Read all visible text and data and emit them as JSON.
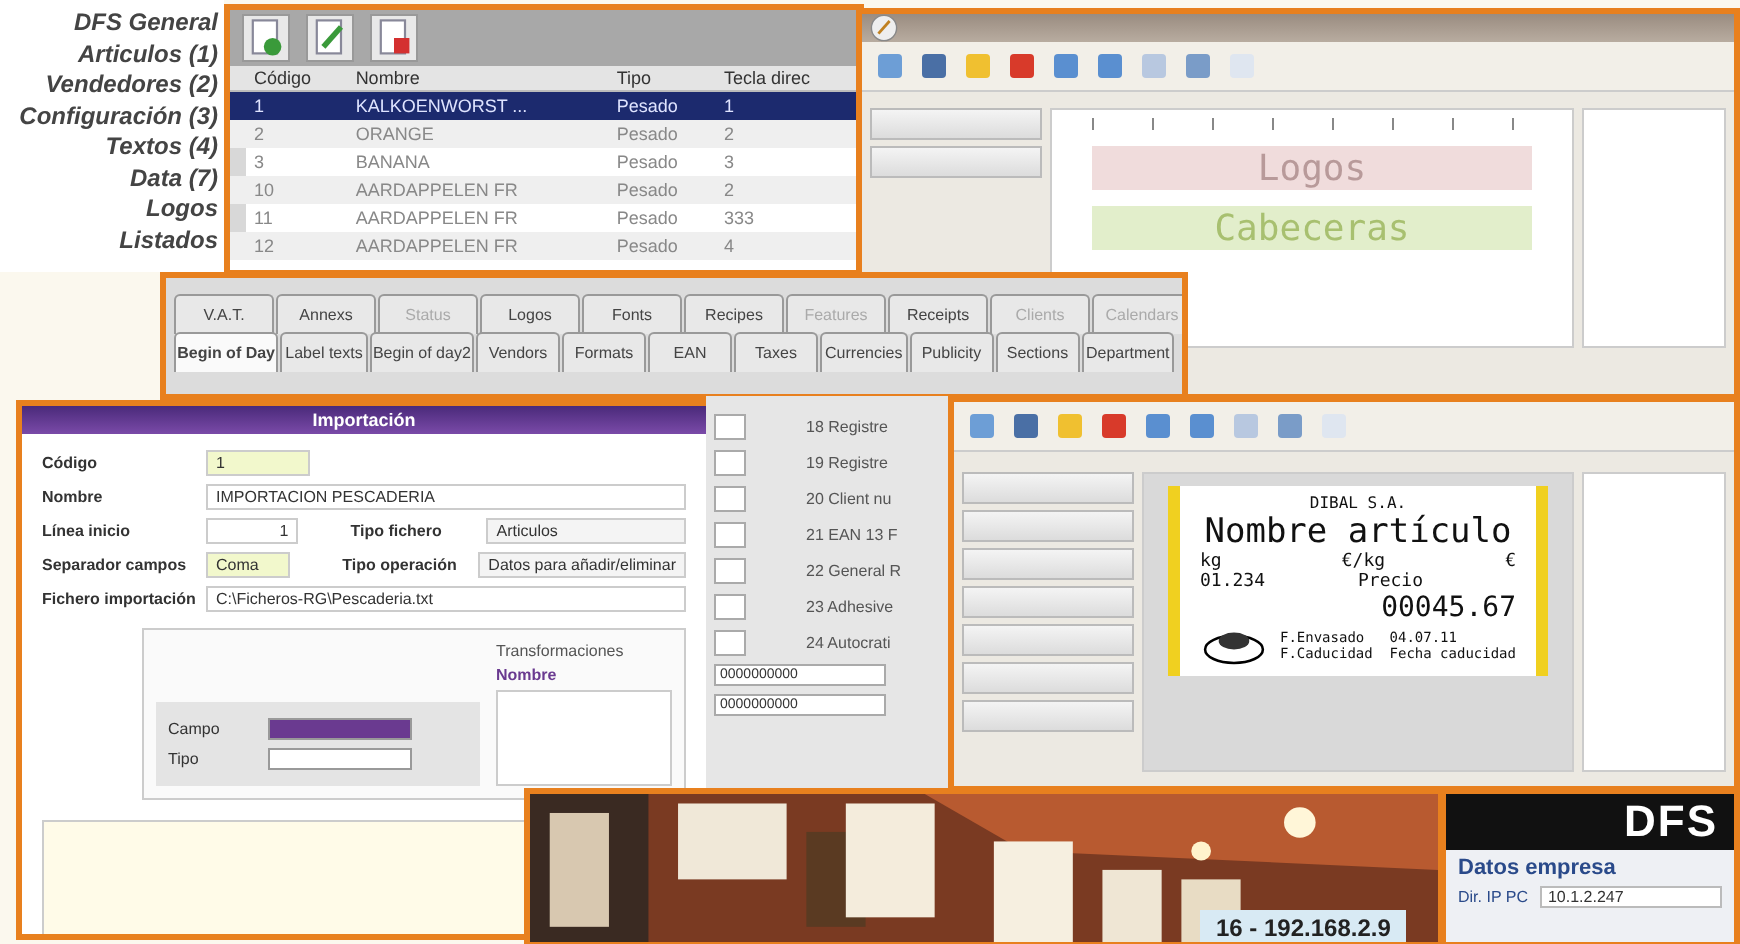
{
  "nav": {
    "items": [
      "DFS General",
      "Articulos (1)",
      "Vendedores (2)",
      "Configuración (3)",
      "Textos (4)",
      "Data (7)",
      "Logos",
      "Listados"
    ]
  },
  "articles_window": {
    "columns": [
      "Código",
      "Nombre",
      "Tipo",
      "Tecla direc"
    ],
    "rows": [
      {
        "cells": [
          "1",
          "KALKOENWORST ...",
          "Pesado",
          "1"
        ],
        "selected": true
      },
      {
        "cells": [
          "2",
          "ORANGE",
          "Pesado",
          "2"
        ],
        "selected": false
      },
      {
        "cells": [
          "3",
          "BANANA",
          "Pesado",
          "3"
        ],
        "selected": false
      },
      {
        "cells": [
          "10",
          "AARDAPPELEN FR",
          "Pesado",
          "2"
        ],
        "selected": false
      },
      {
        "cells": [
          "11",
          "AARDAPPELEN FR",
          "Pesado",
          "333"
        ],
        "selected": false
      },
      {
        "cells": [
          "12",
          "AARDAPPELEN FR",
          "Pesado",
          "4"
        ],
        "selected": false
      }
    ]
  },
  "designer_window": {
    "bands": [
      {
        "text": "Logos",
        "color": "#f0dcdc"
      },
      {
        "text": "Cabeceras",
        "color": "#e2eecb"
      }
    ]
  },
  "config_tabs": {
    "upper_tabs": [
      {
        "label": "V.A.T.",
        "selected": false,
        "disabled": false
      },
      {
        "label": "Annexs",
        "selected": false,
        "disabled": false
      },
      {
        "label": "Status",
        "selected": false,
        "disabled": true
      },
      {
        "label": "Logos",
        "selected": false,
        "disabled": false
      },
      {
        "label": "Fonts",
        "selected": false,
        "disabled": false
      },
      {
        "label": "Recipes",
        "selected": false,
        "disabled": false
      },
      {
        "label": "Features",
        "selected": false,
        "disabled": true
      },
      {
        "label": "Receipts",
        "selected": false,
        "disabled": false
      },
      {
        "label": "Clients",
        "selected": false,
        "disabled": true
      },
      {
        "label": "Calendars",
        "selected": false,
        "disabled": true
      }
    ],
    "lower_tabs": [
      {
        "label": "Begin of Day",
        "selected": true,
        "disabled": false
      },
      {
        "label": "Label texts",
        "selected": false,
        "disabled": false
      },
      {
        "label": "Begin of day2",
        "selected": false,
        "disabled": false
      },
      {
        "label": "Vendors",
        "selected": false,
        "disabled": false
      },
      {
        "label": "Formats",
        "selected": false,
        "disabled": false
      },
      {
        "label": "EAN",
        "selected": false,
        "disabled": false
      },
      {
        "label": "Taxes",
        "selected": false,
        "disabled": false
      },
      {
        "label": "Currencies",
        "selected": false,
        "disabled": false
      },
      {
        "label": "Publicity",
        "selected": false,
        "disabled": false
      },
      {
        "label": "Sections",
        "selected": false,
        "disabled": false
      },
      {
        "label": "Department",
        "selected": false,
        "disabled": false
      }
    ]
  },
  "import_dialog": {
    "title": "Importación",
    "fields": [
      {
        "label": "Código",
        "value": "1"
      },
      {
        "label": "Nombre",
        "value": "IMPORTACION PESCADERIA"
      },
      {
        "label": "Línea inicio",
        "value": "1"
      },
      {
        "label": "Separador campos",
        "value": "Coma"
      },
      {
        "label": "Fichero importación",
        "value": "C:\\Ficheros-RG\\Pescaderia.txt"
      }
    ],
    "side_fields": [
      {
        "label": "Tipo fichero",
        "value": "Articulos"
      },
      {
        "label": "Tipo operación",
        "value": "Datos para añadir/eliminar"
      }
    ],
    "field_rows": [
      "Campo",
      "Tipo"
    ],
    "transform_title": "Transformaciones",
    "transform_column": "Nombre"
  },
  "registers": {
    "items": [
      "18 Registre",
      "19 Registre",
      "20 Client nu",
      "21 EAN 13 F",
      "22 General R",
      "23 Adhesive",
      "24 Autocrati"
    ],
    "codes": [
      "0000000000",
      "0000000000"
    ]
  },
  "label_designer": {
    "company": "DIBAL S.A.",
    "product": "Nombre artículo",
    "unit": "kg",
    "unit_price": "€/kg",
    "currency": "€",
    "weight": "01.234",
    "price_label": "Precio",
    "price": "00045.67",
    "lines": [
      "F.Envasado   04.07.11",
      "F.Caducidad  Fecha caducidad"
    ]
  },
  "photo_strip": {
    "tag": "16 - 192.168.2.9"
  },
  "company_panel": {
    "logo": "DFS",
    "section": "Datos empresa",
    "field_label": "Dir. IP PC",
    "field_value": "10.1.2.247"
  }
}
